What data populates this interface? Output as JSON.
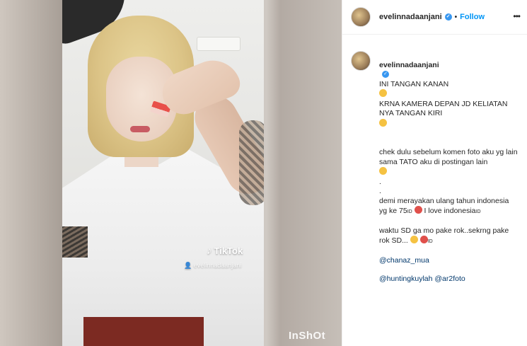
{
  "media": {
    "watermark_app": "TikTok",
    "watermark_user": "evelinnadaanjani",
    "editor_watermark": "InShOt"
  },
  "header": {
    "username": "evelinnadaanjani",
    "separator": "•",
    "follow_label": "Follow",
    "more_label": "•••"
  },
  "caption": {
    "username": "evelinnadaanjani",
    "line1": "INI TANGAN KANAN",
    "line2": "KRNA KAMERA DEPAN JD KELIATAN NYA TANGAN KIRI",
    "line3": "chek dulu sebelum komen foto aku yg lain sama TATO aku di postingan lain",
    "dot1": ".",
    "dot2": ".",
    "line4": "demi merayakan ulang tahun indonesia yg ke 75",
    "line4_suffix": "ID",
    "line4_end": "I love indonesia",
    "line4_end_suffix": "ID",
    "line5": "waktu SD ga mo pake rok..sekrng pake rok SD...",
    "line5_suffix": "ID",
    "mention1": "@chanaz_mua",
    "mention2": "@huntingkuylah",
    "mention3": "@ar2foto"
  },
  "colors": {
    "follow": "#0095f6",
    "verified": "#3897f0",
    "mention": "#00376b"
  },
  "icons": [
    "verified-badge-icon",
    "more-options-icon",
    "tiktok-logo-icon",
    "user-icon"
  ]
}
